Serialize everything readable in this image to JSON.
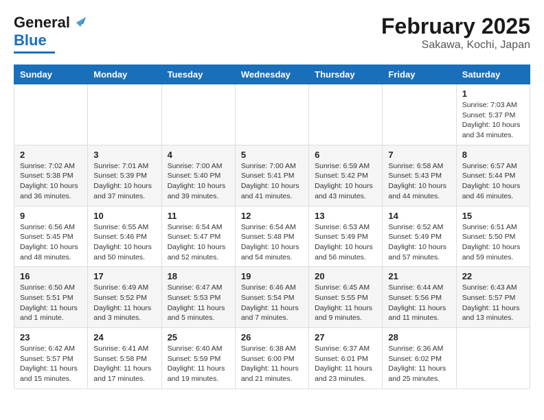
{
  "header": {
    "logo_general": "General",
    "logo_blue": "Blue",
    "month_year": "February 2025",
    "location": "Sakawa, Kochi, Japan"
  },
  "weekdays": [
    "Sunday",
    "Monday",
    "Tuesday",
    "Wednesday",
    "Thursday",
    "Friday",
    "Saturday"
  ],
  "weeks": [
    [
      {
        "day": "",
        "info": ""
      },
      {
        "day": "",
        "info": ""
      },
      {
        "day": "",
        "info": ""
      },
      {
        "day": "",
        "info": ""
      },
      {
        "day": "",
        "info": ""
      },
      {
        "day": "",
        "info": ""
      },
      {
        "day": "1",
        "info": "Sunrise: 7:03 AM\nSunset: 5:37 PM\nDaylight: 10 hours\nand 34 minutes."
      }
    ],
    [
      {
        "day": "2",
        "info": "Sunrise: 7:02 AM\nSunset: 5:38 PM\nDaylight: 10 hours\nand 36 minutes."
      },
      {
        "day": "3",
        "info": "Sunrise: 7:01 AM\nSunset: 5:39 PM\nDaylight: 10 hours\nand 37 minutes."
      },
      {
        "day": "4",
        "info": "Sunrise: 7:00 AM\nSunset: 5:40 PM\nDaylight: 10 hours\nand 39 minutes."
      },
      {
        "day": "5",
        "info": "Sunrise: 7:00 AM\nSunset: 5:41 PM\nDaylight: 10 hours\nand 41 minutes."
      },
      {
        "day": "6",
        "info": "Sunrise: 6:59 AM\nSunset: 5:42 PM\nDaylight: 10 hours\nand 43 minutes."
      },
      {
        "day": "7",
        "info": "Sunrise: 6:58 AM\nSunset: 5:43 PM\nDaylight: 10 hours\nand 44 minutes."
      },
      {
        "day": "8",
        "info": "Sunrise: 6:57 AM\nSunset: 5:44 PM\nDaylight: 10 hours\nand 46 minutes."
      }
    ],
    [
      {
        "day": "9",
        "info": "Sunrise: 6:56 AM\nSunset: 5:45 PM\nDaylight: 10 hours\nand 48 minutes."
      },
      {
        "day": "10",
        "info": "Sunrise: 6:55 AM\nSunset: 5:46 PM\nDaylight: 10 hours\nand 50 minutes."
      },
      {
        "day": "11",
        "info": "Sunrise: 6:54 AM\nSunset: 5:47 PM\nDaylight: 10 hours\nand 52 minutes."
      },
      {
        "day": "12",
        "info": "Sunrise: 6:54 AM\nSunset: 5:48 PM\nDaylight: 10 hours\nand 54 minutes."
      },
      {
        "day": "13",
        "info": "Sunrise: 6:53 AM\nSunset: 5:49 PM\nDaylight: 10 hours\nand 56 minutes."
      },
      {
        "day": "14",
        "info": "Sunrise: 6:52 AM\nSunset: 5:49 PM\nDaylight: 10 hours\nand 57 minutes."
      },
      {
        "day": "15",
        "info": "Sunrise: 6:51 AM\nSunset: 5:50 PM\nDaylight: 10 hours\nand 59 minutes."
      }
    ],
    [
      {
        "day": "16",
        "info": "Sunrise: 6:50 AM\nSunset: 5:51 PM\nDaylight: 11 hours\nand 1 minute."
      },
      {
        "day": "17",
        "info": "Sunrise: 6:49 AM\nSunset: 5:52 PM\nDaylight: 11 hours\nand 3 minutes."
      },
      {
        "day": "18",
        "info": "Sunrise: 6:47 AM\nSunset: 5:53 PM\nDaylight: 11 hours\nand 5 minutes."
      },
      {
        "day": "19",
        "info": "Sunrise: 6:46 AM\nSunset: 5:54 PM\nDaylight: 11 hours\nand 7 minutes."
      },
      {
        "day": "20",
        "info": "Sunrise: 6:45 AM\nSunset: 5:55 PM\nDaylight: 11 hours\nand 9 minutes."
      },
      {
        "day": "21",
        "info": "Sunrise: 6:44 AM\nSunset: 5:56 PM\nDaylight: 11 hours\nand 11 minutes."
      },
      {
        "day": "22",
        "info": "Sunrise: 6:43 AM\nSunset: 5:57 PM\nDaylight: 11 hours\nand 13 minutes."
      }
    ],
    [
      {
        "day": "23",
        "info": "Sunrise: 6:42 AM\nSunset: 5:57 PM\nDaylight: 11 hours\nand 15 minutes."
      },
      {
        "day": "24",
        "info": "Sunrise: 6:41 AM\nSunset: 5:58 PM\nDaylight: 11 hours\nand 17 minutes."
      },
      {
        "day": "25",
        "info": "Sunrise: 6:40 AM\nSunset: 5:59 PM\nDaylight: 11 hours\nand 19 minutes."
      },
      {
        "day": "26",
        "info": "Sunrise: 6:38 AM\nSunset: 6:00 PM\nDaylight: 11 hours\nand 21 minutes."
      },
      {
        "day": "27",
        "info": "Sunrise: 6:37 AM\nSunset: 6:01 PM\nDaylight: 11 hours\nand 23 minutes."
      },
      {
        "day": "28",
        "info": "Sunrise: 6:36 AM\nSunset: 6:02 PM\nDaylight: 11 hours\nand 25 minutes."
      },
      {
        "day": "",
        "info": ""
      }
    ]
  ]
}
